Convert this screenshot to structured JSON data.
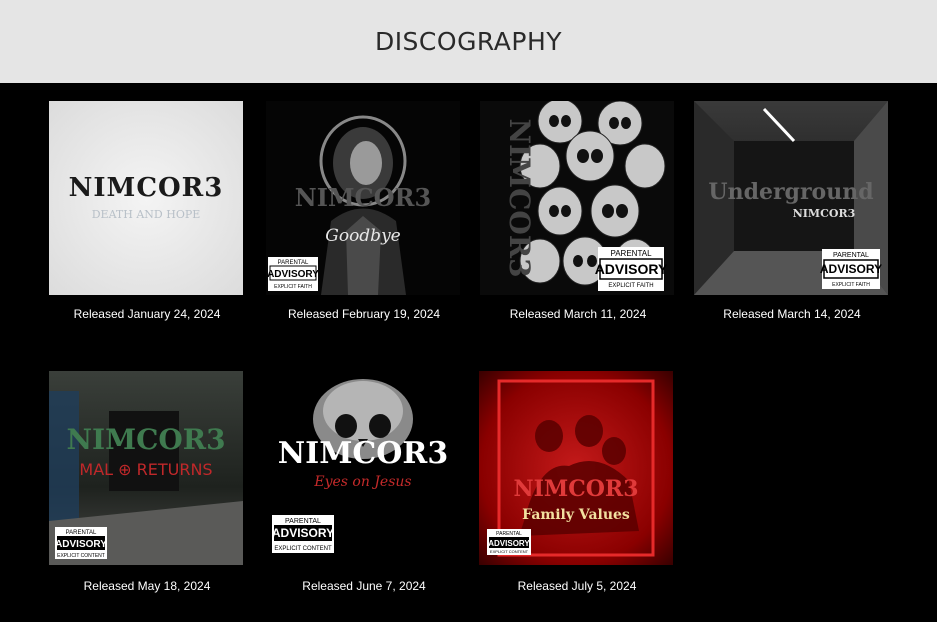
{
  "header": {
    "title": "DISCOGRAPHY"
  },
  "albums": [
    {
      "released": "Released January 24, 2024",
      "logo": "NIMCOR3",
      "subtitle": "DEATH AND HOPE",
      "advisory": null
    },
    {
      "released": "Released February 19, 2024",
      "logo": "NIMCOR3",
      "subtitle": "Goodbye",
      "advisory": {
        "top": "PARENTAL",
        "mid": "ADVISORY",
        "bot": "EXPLICIT FAITH"
      }
    },
    {
      "released": "Released March 11, 2024",
      "logo": "NIMCOR3",
      "subtitle": "",
      "advisory": {
        "top": "PARENTAL",
        "mid": "ADVISORY",
        "bot": "EXPLICIT FAITH"
      }
    },
    {
      "released": "Released March 14, 2024",
      "logo": "NIMCOR3",
      "subtitle": "Underground",
      "advisory": {
        "top": "PARENTAL",
        "mid": "ADVISORY",
        "bot": "EXPLICIT FAITH"
      }
    },
    {
      "released": "Released May 18, 2024",
      "logo": "NIMCOR3",
      "subtitle": "MAL ⊕ RETURNS",
      "advisory": {
        "top": "PARENTAL",
        "mid": "ADVISORY",
        "bot": "EXPLICIT CONTENT"
      }
    },
    {
      "released": "Released June 7, 2024",
      "logo": "NIMCOR3",
      "subtitle": "Eyes on Jesus",
      "advisory": {
        "top": "PARENTAL",
        "mid": "ADVISORY",
        "bot": "EXPLICIT CONTENT"
      }
    },
    {
      "released": "Released July 5, 2024",
      "logo": "NIMCOR3",
      "subtitle": "Family Values",
      "advisory": {
        "top": "PARENTAL",
        "mid": "ADVISORY",
        "bot": "EXPLICIT CONTENT"
      }
    }
  ]
}
